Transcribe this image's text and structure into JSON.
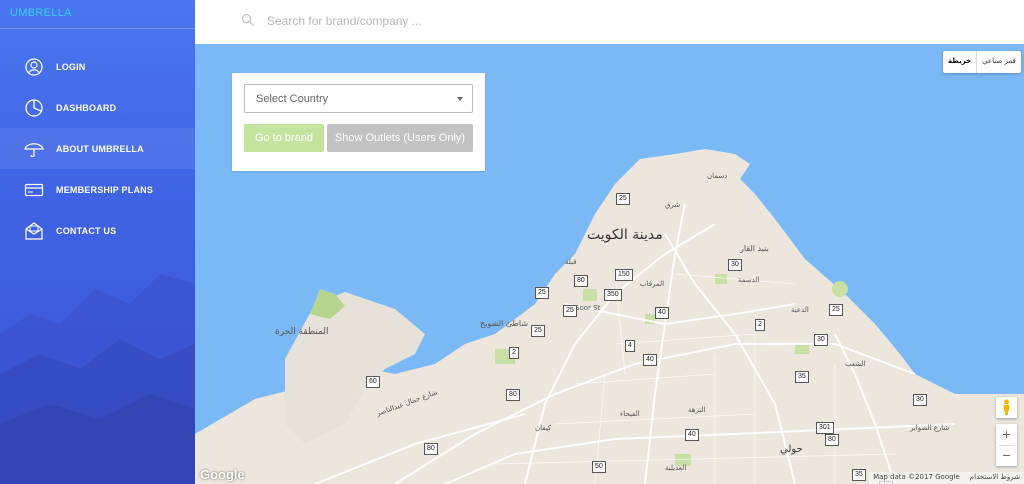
{
  "app": {
    "brand": "UMBRELLA"
  },
  "sidebar": {
    "items": [
      {
        "label": "LOGIN",
        "icon": "user-circle-icon"
      },
      {
        "label": "DASHBOARD",
        "icon": "pie-chart-icon"
      },
      {
        "label": "ABOUT UMBRELLA",
        "icon": "umbrella-icon",
        "active": true
      },
      {
        "label": "MEMBERSHIP PLANS",
        "icon": "credit-card-icon"
      },
      {
        "label": "CONTACT US",
        "icon": "mail-icon"
      }
    ]
  },
  "search": {
    "placeholder": "Search for brand/company ...",
    "value": ""
  },
  "panel": {
    "country_select": "Select Country",
    "go_to_brand": "Go to brand",
    "show_outlets": "Show Outlets (Users Only)"
  },
  "map": {
    "type_toggle": {
      "map": "خريطة",
      "satellite": "قمر صناعي"
    },
    "labels": {
      "city": "مدينة الكويت",
      "free_zone": "المنطقة الحرة",
      "hawally": "حولي",
      "souq_st": "Soor St",
      "dasman": "دسمان",
      "bneid_alqar": "بنيد القار",
      "sharq": "شرق",
      "mirqab": "المرقاب",
      "qibla": "قبلة",
      "shuwaikh": "شاطئ الشويخ",
      "daiya": "الدعية",
      "dasma": "الدسمة",
      "shaab": "الشعب",
      "faiha": "الفيحاء",
      "nuzha": "النزهة",
      "kifan": "كيفان",
      "adailiya": "العديلية",
      "sawaber": "شارع الصوابر",
      "jabriya": "شارع جمال عبدالناصر"
    },
    "shields": [
      "25",
      "25",
      "150",
      "80",
      "350",
      "25",
      "2",
      "4",
      "40",
      "30",
      "30",
      "60",
      "80",
      "80",
      "2",
      "50",
      "40",
      "301",
      "35",
      "35",
      "30",
      "25",
      "80",
      "40",
      "40",
      "25"
    ],
    "google": "Google",
    "attribution": {
      "data": "Map data ©2017 Google",
      "terms": "شروط الاستخدام"
    },
    "zoom_in": "+",
    "zoom_out": "−",
    "colors": {
      "water": "#7bb9f6",
      "land": "#ece6dc",
      "park": "#c8dfa6",
      "road": "#ffffff"
    }
  }
}
